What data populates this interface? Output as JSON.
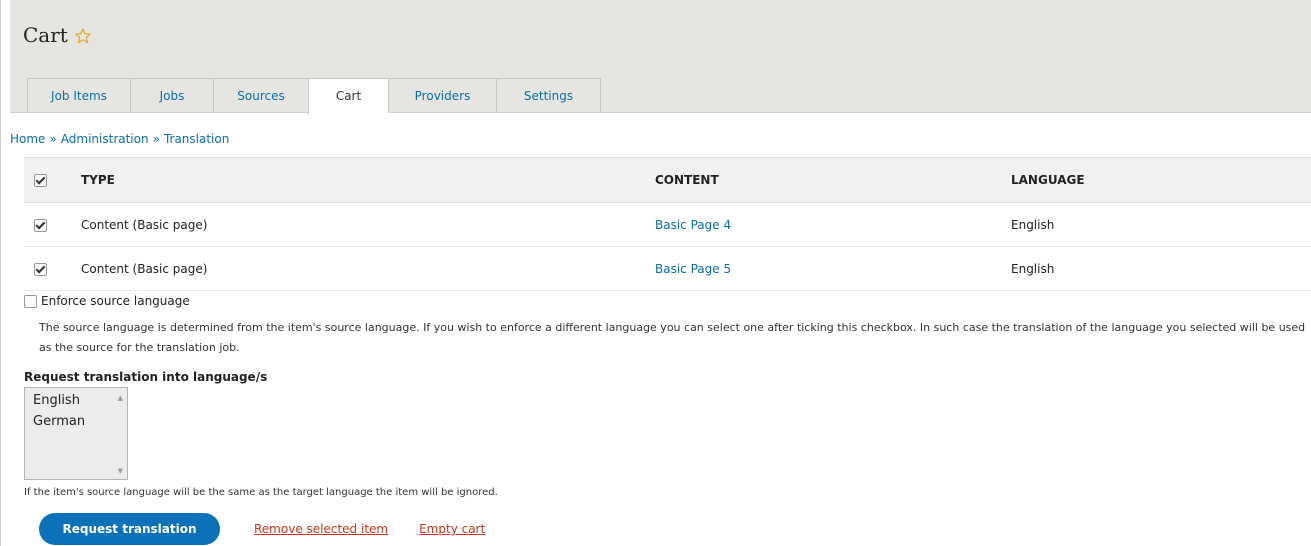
{
  "page": {
    "title": "Cart",
    "favorite_icon": "star-outline-icon"
  },
  "tabs": [
    {
      "label": "Job Items",
      "active": false
    },
    {
      "label": "Jobs",
      "active": false
    },
    {
      "label": "Sources",
      "active": false
    },
    {
      "label": "Cart",
      "active": true
    },
    {
      "label": "Providers",
      "active": false
    },
    {
      "label": "Settings",
      "active": false
    }
  ],
  "breadcrumb": [
    "Home",
    "Administration",
    "Translation"
  ],
  "breadcrumb_separator": "»",
  "table": {
    "headers": {
      "type": "TYPE",
      "content": "CONTENT",
      "language": "LANGUAGE"
    },
    "select_all_checked": true,
    "rows": [
      {
        "checked": true,
        "type": "Content (Basic page)",
        "content": "Basic Page 4",
        "language": "English"
      },
      {
        "checked": true,
        "type": "Content (Basic page)",
        "content": "Basic Page 5",
        "language": "English"
      }
    ]
  },
  "enforce": {
    "label": "Enforce source language",
    "checked": false,
    "description": "The source language is determined from the item's source language. If you wish to enforce a different language you can select one after ticking this checkbox. In such case the translation of the language you selected will be used as the source for the translation job."
  },
  "request_language": {
    "label": "Request translation into language/s",
    "options": [
      "English",
      "German"
    ],
    "help": "If the item's source language will be the same as the target language the item will be ignored."
  },
  "actions": {
    "request_label": "Request translation",
    "remove_label": "Remove selected item",
    "empty_label": "Empty cart"
  },
  "colors": {
    "link": "#0a6ea8",
    "primary_button": "#0b72b9",
    "danger_link": "#c8331f",
    "header_bg": "#e6e5e1"
  }
}
